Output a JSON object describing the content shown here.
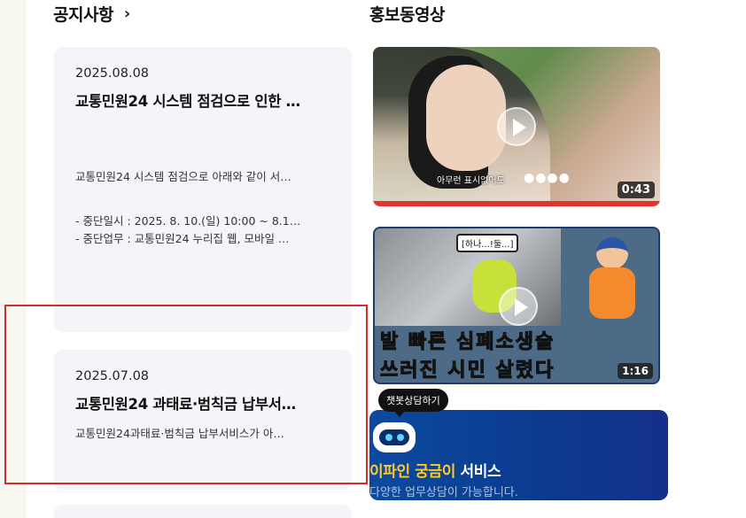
{
  "notice": {
    "title": "공지사항",
    "more_icon": "chevron-right-icon",
    "cards": [
      {
        "date": "2025.08.08",
        "title": "교통민원24 시스템 점검으로 인한 …",
        "body": "교통민원24 시스템 점검으로 아래와 같이 서…",
        "lines": [
          "- 중단일시 : 2025. 8. 10.(일) 10:00 ~ 8.1…",
          "- 중단업무 : 교통민원24 누리집 웹, 모바일 …"
        ]
      },
      {
        "date": "2025.07.08",
        "title": "교통민원24 과태료·범칙금 납부서…",
        "body": "교통민원24과태료·범칙금 납부서비스가 아…"
      }
    ]
  },
  "videos": {
    "title": "홍보동영상",
    "items": [
      {
        "caption": "아무런 표시없어도",
        "duration": "0:43"
      },
      {
        "tag": "[하나...!둘...]",
        "line1": "발 빠른 심폐소생술",
        "line2": "쓰러진 시민 살렸다",
        "duration": "1:16"
      }
    ]
  },
  "chatbot": {
    "tooltip": "챗봇상담하기",
    "headline_accent": "이파인 궁금이",
    "headline_rest": " 서비스",
    "subtitle": "다양한 업무상담이 가능합니다.",
    "icon": "chatbot-robot-icon"
  },
  "colors": {
    "card_bg": "#f3f5f9",
    "highlight": "#d92a2a",
    "chat_bg": "#0b3a8d",
    "chat_accent": "#ffc928",
    "video_bar": "#e0342e"
  }
}
